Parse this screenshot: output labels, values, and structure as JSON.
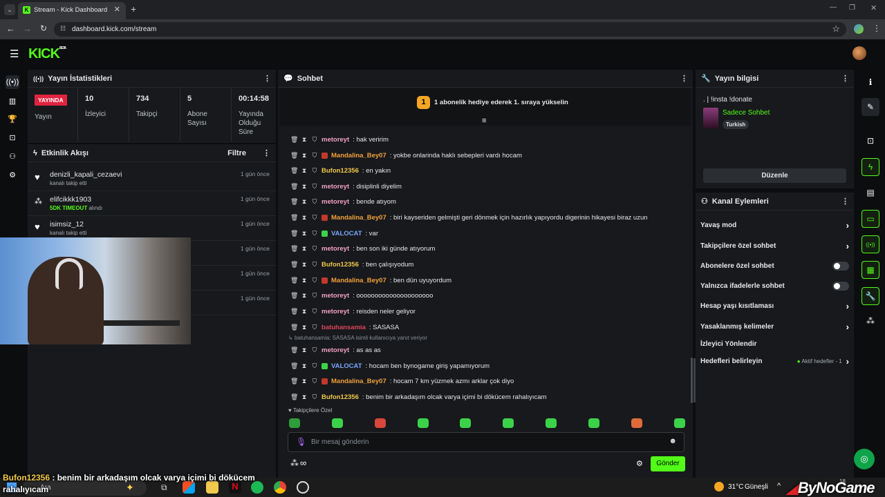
{
  "browser": {
    "tab_title": "Stream - Kick Dashboard",
    "url": "dashboard.kick.com/stream"
  },
  "app": {
    "logo": "KICK",
    "logo_sup": "BETA"
  },
  "stats_panel": {
    "title": "Yayın İstatistikleri",
    "live_badge": "YAYINDA",
    "live_label": "Yayın",
    "stats": [
      {
        "value": "10",
        "label": "İzleyici"
      },
      {
        "value": "734",
        "label": "Takipçi"
      },
      {
        "value": "5",
        "label": "Abone Sayısı"
      },
      {
        "value": "00:14:58",
        "label": "Yayında Olduğu Süre"
      }
    ]
  },
  "activity_panel": {
    "title": "Etkinlik Akışı",
    "filter": "Filtre",
    "events": [
      {
        "name": "denizli_kapali_cezaevi",
        "sub": "kanalı takip etti",
        "time": "1 gün önce"
      },
      {
        "name": "elifcikkk1903",
        "sub_em": "5DK TIMEOUT",
        "sub": "alındı",
        "time": "1 gün önce"
      },
      {
        "name": "isimsiz_12",
        "sub": "kanalı takip etti",
        "time": "1 gün önce"
      },
      {
        "time": "1 gün önce"
      },
      {
        "time": "1 gün önce"
      },
      {
        "time": "1 gün önce"
      }
    ]
  },
  "chat": {
    "title": "Sohbet",
    "goal_number": "1",
    "goal_text": "1 abonelik hediye ederek 1. sıraya yükselin",
    "messages": [
      {
        "user": "metoreyt",
        "color": "#f3a1c4",
        "text": ": hak veririm"
      },
      {
        "user": "Mandalina_Bey07",
        "color": "#f2a13b",
        "text": ": yokbe onlarinda haklı sebepleri vardı hocam"
      },
      {
        "user": "Bufon12356",
        "color": "#f2c94c",
        "text": ": en yakın"
      },
      {
        "user": "metoreyt",
        "color": "#f3a1c4",
        "text": ": disiplinli diyelim"
      },
      {
        "user": "metoreyt",
        "color": "#f3a1c4",
        "text": ": bende atıyom"
      },
      {
        "user": "Mandalina_Bey07",
        "color": "#f2a13b",
        "text": ": biri kayseriden gelmişti geri dönmek için hazırlık yapıyordu digerinin hikayesi biraz uzun"
      },
      {
        "user": "VALOCAT",
        "color": "#7aa6ff",
        "text": ": var"
      },
      {
        "user": "metoreyt",
        "color": "#f3a1c4",
        "text": ": ben son iki günde atıyorum"
      },
      {
        "user": "Bufon12356",
        "color": "#f2c94c",
        "text": ": ben çalışıyodum"
      },
      {
        "user": "Mandalina_Bey07",
        "color": "#f2a13b",
        "text": ": ben dün uyuyordum"
      },
      {
        "user": "metoreyt",
        "color": "#f3a1c4",
        "text": ": ooooooooooooooooooooo"
      },
      {
        "user": "metoreyt",
        "color": "#f3a1c4",
        "text": ": reisden neler geliyor"
      },
      {
        "user": "batuhansamia",
        "color": "#e0445a",
        "text": ": SASASA"
      },
      {
        "user": "metoreyt",
        "color": "#f3a1c4",
        "text": ": as as as"
      },
      {
        "user": "VALOCAT",
        "color": "#7aa6ff",
        "text": ": hocam ben bynogame giriş yapamıyorum"
      },
      {
        "user": "Mandalina_Bey07",
        "color": "#f2a13b",
        "text": ": hocam 7 km yüzmek azmı arklar çok diyo"
      },
      {
        "user": "Bufon12356",
        "color": "#f2c94c",
        "text": ": benim bir arkadaşım olcak varya içimi bi dökücem rahalıyıcam"
      }
    ],
    "reply_hint": "batuhansamia: SASASA isimli kullanıcıya yanıt veriyor",
    "followers_only_label": "Takipçilere Özel",
    "input_placeholder": "Bir mesaj gönderin",
    "send_label": "Gönder",
    "infinity": "∞"
  },
  "stream_info": {
    "title": "Yayın bilgisi",
    "stream_title": ". | !insta !donate",
    "category": "Sadece Sohbet",
    "language": "Turkish",
    "edit_label": "Düzenle"
  },
  "channel_actions": {
    "title": "Kanal Eylemleri",
    "items": [
      {
        "label": "Yavaş mod",
        "control": "chevron"
      },
      {
        "label": "Takipçilere özel sohbet",
        "control": "chevron"
      },
      {
        "label": "Abonelere özel sohbet",
        "control": "toggle"
      },
      {
        "label": "Yalnızca ifadelerle sohbet",
        "control": "toggle"
      },
      {
        "label": "Hesap yaşı kısıtlaması",
        "control": "chevron"
      },
      {
        "label": "Yasaklanmış kelimeler",
        "control": "chevron"
      },
      {
        "label": "İzleyici Yönlendir",
        "control": "none"
      },
      {
        "label": "Hedefleri belirleyin",
        "control": "chevron",
        "extra": "Aktif hedefler - 1"
      }
    ]
  },
  "overlay": {
    "caption_user": "Bufon12356",
    "caption_text": " : benim bir arkadaşım olcak varya içimi bi dökücem",
    "caption_text2": "rahalıyıcam",
    "watermark": "ByNoGame"
  },
  "taskbar": {
    "search_text": "Ara",
    "weather": "31°C",
    "weather_desc": "Güneşli",
    "clock": "18"
  }
}
